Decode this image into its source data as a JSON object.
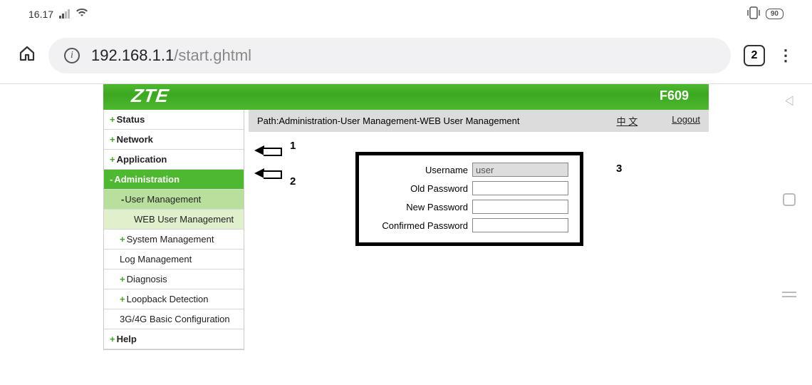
{
  "status_bar": {
    "time": "16.17",
    "battery": "90"
  },
  "browser": {
    "url_host": "192.168.1.1",
    "url_path": "/start.ghtml",
    "tab_count": "2"
  },
  "router": {
    "brand": "ZTE",
    "model": "F609",
    "path_label": "Path:Administration-User Management-WEB User Management",
    "lang_link": "中 文",
    "logout": "Logout"
  },
  "nav": {
    "status": "Status",
    "network": "Network",
    "application": "Application",
    "administration": "Administration",
    "user_management": "User Management",
    "web_user_management": "WEB User Management",
    "system_management": "System Management",
    "log_management": "Log Management",
    "diagnosis": "Diagnosis",
    "loopback": "Loopback Detection",
    "basic_config": "3G/4G Basic Configuration",
    "help": "Help"
  },
  "form": {
    "username_label": "Username",
    "username_value": "user",
    "old_password_label": "Old Password",
    "new_password_label": "New Password",
    "confirmed_password_label": "Confirmed Password"
  },
  "annotations": {
    "a1": "1",
    "a2": "2",
    "a3": "3"
  }
}
